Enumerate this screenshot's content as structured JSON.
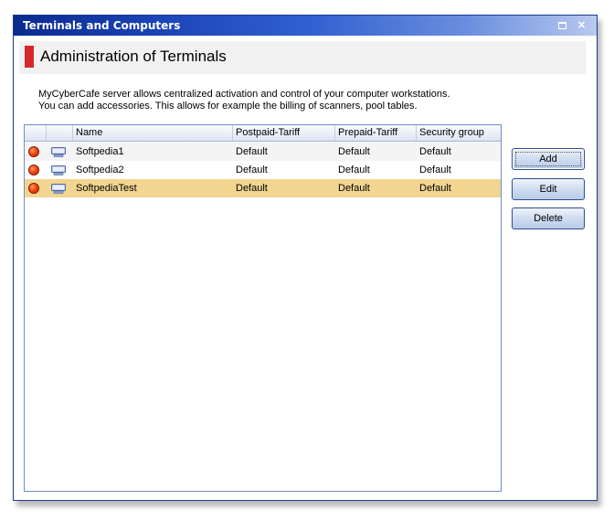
{
  "window": {
    "title": "Terminals and Computers",
    "restore_icon": "restore-icon",
    "close_glyph": "×"
  },
  "header": {
    "title": "Administration of Terminals",
    "accent_color": "#d7272b"
  },
  "description": {
    "line1": "MyCyberCafe server allows centralized activation and control of your computer workstations.",
    "line2": "You can add accessories. This allows for example the billing of scanners, pool tables."
  },
  "table": {
    "columns": [
      "",
      "",
      "Name",
      "Postpaid-Tariff",
      "Prepaid-Tariff",
      "Security group"
    ],
    "rows": [
      {
        "name": "Softpedia1",
        "postpaid": "Default",
        "prepaid": "Default",
        "security": "Default",
        "status_icon": "status-red-icon",
        "type_icon": "computer-icon"
      },
      {
        "name": "Softpedia2",
        "postpaid": "Default",
        "prepaid": "Default",
        "security": "Default",
        "status_icon": "status-red-icon",
        "type_icon": "computer-icon"
      },
      {
        "name": "SoftpediaTest",
        "postpaid": "Default",
        "prepaid": "Default",
        "security": "Default",
        "status_icon": "status-red-icon",
        "type_icon": "computer-icon",
        "selected": true
      }
    ],
    "selected_color": "#f2d591"
  },
  "buttons": {
    "add": "Add",
    "edit": "Edit",
    "delete": "Delete"
  }
}
